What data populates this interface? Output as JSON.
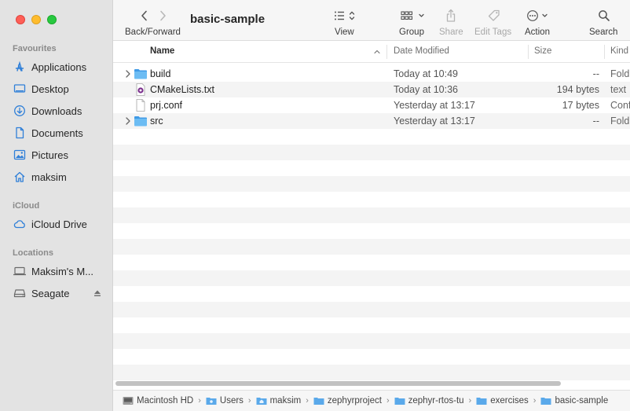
{
  "window": {
    "title": "basic-sample"
  },
  "toolbar": {
    "nav_label": "Back/Forward",
    "view_label": "View",
    "group_label": "Group",
    "share_label": "Share",
    "edit_tags_label": "Edit Tags",
    "action_label": "Action",
    "search_label": "Search"
  },
  "sidebar": {
    "favourites_title": "Favourites",
    "favourites": [
      {
        "label": "Applications",
        "icon": "applications-icon"
      },
      {
        "label": "Desktop",
        "icon": "desktop-icon"
      },
      {
        "label": "Downloads",
        "icon": "downloads-icon"
      },
      {
        "label": "Documents",
        "icon": "documents-icon"
      },
      {
        "label": "Pictures",
        "icon": "pictures-icon"
      },
      {
        "label": "maksim",
        "icon": "home-icon"
      }
    ],
    "icloud_title": "iCloud",
    "icloud": [
      {
        "label": "iCloud Drive",
        "icon": "cloud-icon"
      }
    ],
    "locations_title": "Locations",
    "locations": [
      {
        "label": "Maksim's M...",
        "icon": "laptop-icon"
      },
      {
        "label": "Seagate",
        "icon": "drive-icon"
      }
    ]
  },
  "columns": {
    "name": "Name",
    "date_modified": "Date Modified",
    "size": "Size",
    "kind": "Kind"
  },
  "files": [
    {
      "name": "build",
      "date": "Today at 10:49",
      "size": "--",
      "kind": "Fold",
      "type": "folder",
      "expandable": true
    },
    {
      "name": "CMakeLists.txt",
      "date": "Today at 10:36",
      "size": "194 bytes",
      "kind": "text",
      "type": "cmake",
      "expandable": false
    },
    {
      "name": "prj.conf",
      "date": "Yesterday at 13:17",
      "size": "17 bytes",
      "kind": "Conf",
      "type": "document",
      "expandable": false
    },
    {
      "name": "src",
      "date": "Yesterday at 13:17",
      "size": "--",
      "kind": "Fold",
      "type": "folder",
      "expandable": true
    }
  ],
  "path": [
    {
      "label": "Macintosh HD",
      "icon": "hard-drive-icon"
    },
    {
      "label": "Users",
      "icon": "folder-icon"
    },
    {
      "label": "maksim",
      "icon": "home-folder-icon"
    },
    {
      "label": "zephyrproject",
      "icon": "folder-icon"
    },
    {
      "label": "zephyr-rtos-tu",
      "icon": "folder-icon"
    },
    {
      "label": "exercises",
      "icon": "folder-icon"
    },
    {
      "label": "basic-sample",
      "icon": "folder-icon"
    }
  ],
  "colors": {
    "accent": "#1f7ae0",
    "folder": "#5fb3f0",
    "sidebar_bg": "#e3e3e3"
  }
}
